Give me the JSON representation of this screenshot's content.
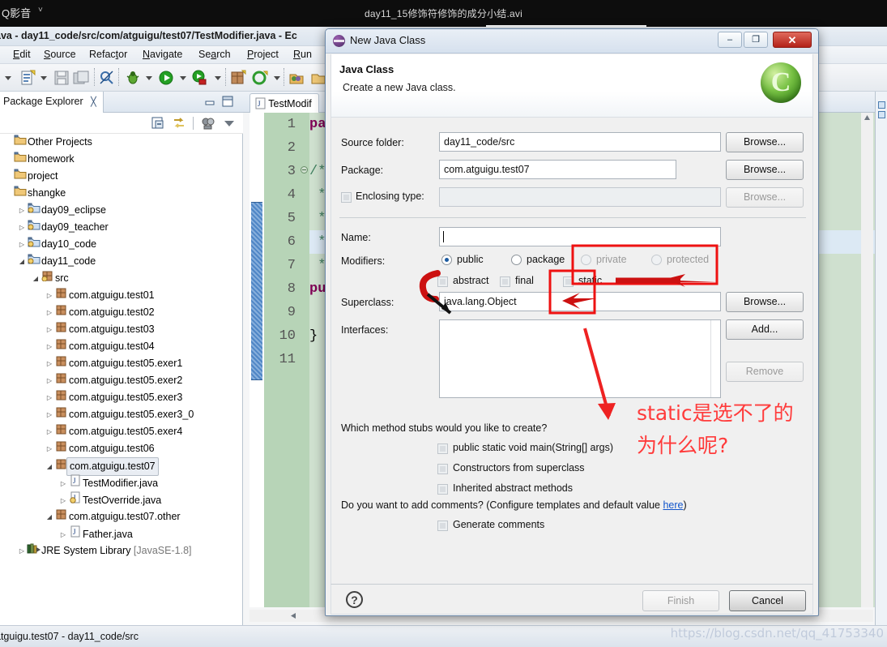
{
  "player": {
    "app_name": "Q影音",
    "caret": "˅",
    "video_title": "day11_15修饰符修饰的成分小结.avi"
  },
  "eclipse": {
    "window_title": "ava - day11_code/src/com/atguigu/test07/TestModifier.java - Ec",
    "menus": [
      "Edit",
      "Source",
      "Refactor",
      "Navigate",
      "Search",
      "Project",
      "Run"
    ],
    "status_text": "atguigu.test07 - day11_code/src"
  },
  "package_explorer": {
    "tab_label": "Package Explorer",
    "tab_close": "╳",
    "toolbar_icons": [
      "collapse-all-icon",
      "link-with-editor-icon",
      "view-menu-icon",
      "view-dropdown-icon"
    ],
    "minimize_label": "–",
    "maximize_label": "❐",
    "tree": [
      {
        "label": "Other Projects",
        "indent": 0,
        "twisty": "none",
        "icon": "project-folder-icon",
        "selected": false
      },
      {
        "label": "homework",
        "indent": 0,
        "twisty": "none",
        "icon": "project-folder-icon",
        "selected": false
      },
      {
        "label": "project",
        "indent": 0,
        "twisty": "none",
        "icon": "project-folder-icon",
        "selected": false
      },
      {
        "label": "shangke",
        "indent": 0,
        "twisty": "none",
        "icon": "project-folder-icon",
        "selected": false
      },
      {
        "label": "day09_eclipse",
        "indent": 1,
        "twisty": "collapsed",
        "icon": "java-project-icon",
        "selected": false
      },
      {
        "label": "day09_teacher",
        "indent": 1,
        "twisty": "collapsed",
        "icon": "java-project-icon",
        "selected": false
      },
      {
        "label": "day10_code",
        "indent": 1,
        "twisty": "collapsed",
        "icon": "java-project-icon",
        "selected": false
      },
      {
        "label": "day11_code",
        "indent": 1,
        "twisty": "expanded",
        "icon": "java-project-icon",
        "selected": false
      },
      {
        "label": "src",
        "indent": 2,
        "twisty": "expanded",
        "icon": "source-folder-icon",
        "selected": false
      },
      {
        "label": "com.atguigu.test01",
        "indent": 3,
        "twisty": "collapsed",
        "icon": "package-icon",
        "selected": false
      },
      {
        "label": "com.atguigu.test02",
        "indent": 3,
        "twisty": "collapsed",
        "icon": "package-icon",
        "selected": false
      },
      {
        "label": "com.atguigu.test03",
        "indent": 3,
        "twisty": "collapsed",
        "icon": "package-icon",
        "selected": false
      },
      {
        "label": "com.atguigu.test04",
        "indent": 3,
        "twisty": "collapsed",
        "icon": "package-icon",
        "selected": false
      },
      {
        "label": "com.atguigu.test05.exer1",
        "indent": 3,
        "twisty": "collapsed",
        "icon": "package-icon",
        "selected": false
      },
      {
        "label": "com.atguigu.test05.exer2",
        "indent": 3,
        "twisty": "collapsed",
        "icon": "package-icon",
        "selected": false
      },
      {
        "label": "com.atguigu.test05.exer3",
        "indent": 3,
        "twisty": "collapsed",
        "icon": "package-icon",
        "selected": false
      },
      {
        "label": "com.atguigu.test05.exer3_0",
        "indent": 3,
        "twisty": "collapsed",
        "icon": "package-icon",
        "selected": false
      },
      {
        "label": "com.atguigu.test05.exer4",
        "indent": 3,
        "twisty": "collapsed",
        "icon": "package-icon",
        "selected": false
      },
      {
        "label": "com.atguigu.test06",
        "indent": 3,
        "twisty": "collapsed",
        "icon": "package-icon",
        "selected": false
      },
      {
        "label": "com.atguigu.test07",
        "indent": 3,
        "twisty": "expanded",
        "icon": "package-icon",
        "selected": true
      },
      {
        "label": "TestModifier.java",
        "indent": 4,
        "twisty": "collapsed",
        "icon": "java-file-icon",
        "selected": false
      },
      {
        "label": "TestOverride.java",
        "indent": 4,
        "twisty": "collapsed",
        "icon": "java-file-warning-icon",
        "selected": false
      },
      {
        "label": "com.atguigu.test07.other",
        "indent": 3,
        "twisty": "expanded",
        "icon": "package-icon",
        "selected": false
      },
      {
        "label": "Father.java",
        "indent": 4,
        "twisty": "collapsed",
        "icon": "java-file-icon",
        "selected": false
      },
      {
        "label": "JRE System Library [JavaSE-1.8]",
        "indent": 1,
        "twisty": "collapsed",
        "icon": "library-icon",
        "selected": false
      }
    ]
  },
  "editor": {
    "tab_label": "TestModif",
    "line_numbers": [
      "1",
      "2",
      "3",
      "4",
      "5",
      "6",
      "7",
      "8",
      "9",
      "10",
      "11"
    ],
    "code_lines": [
      {
        "text": "pac",
        "kind": "keyword"
      },
      {
        "text": "",
        "kind": "plain"
      },
      {
        "text": "/*",
        "kind": "comment"
      },
      {
        "text": " *",
        "kind": "comment"
      },
      {
        "text": " *",
        "kind": "comment"
      },
      {
        "text": " *",
        "kind": "comment",
        "highlight": true
      },
      {
        "text": " */",
        "kind": "comment"
      },
      {
        "text": "pub",
        "kind": "keyword"
      },
      {
        "text": "",
        "kind": "plain"
      },
      {
        "text": "}",
        "kind": "plain"
      },
      {
        "text": "",
        "kind": "plain"
      }
    ]
  },
  "dialog": {
    "title": "New Java Class",
    "window_buttons": {
      "minimize": "–",
      "maximize": "❐",
      "close": "✕"
    },
    "header_title": "Java Class",
    "header_subtitle": "Create a new Java class.",
    "fields": {
      "source_folder_label": "Source folder:",
      "source_folder_value": "day11_code/src",
      "source_folder_browse": "Browse...",
      "package_label": "Package:",
      "package_value": "com.atguigu.test07",
      "package_browse": "Browse...",
      "enclosing_type_label": "Enclosing type:",
      "enclosing_type_value": "",
      "enclosing_type_browse": "Browse...",
      "name_label": "Name:",
      "name_value": "",
      "modifiers_label": "Modifiers:",
      "superclass_label": "Superclass:",
      "superclass_value": "java.lang.Object",
      "superclass_browse": "Browse...",
      "interfaces_label": "Interfaces:",
      "interfaces_add": "Add...",
      "interfaces_remove": "Remove"
    },
    "modifiers": {
      "radios": [
        {
          "label": "public",
          "selected": true,
          "enabled": true
        },
        {
          "label": "package",
          "selected": false,
          "enabled": true
        },
        {
          "label": "private",
          "selected": false,
          "enabled": false
        },
        {
          "label": "protected",
          "selected": false,
          "enabled": false
        }
      ],
      "checks": [
        {
          "label": "abstract",
          "checked": false,
          "enabled": false
        },
        {
          "label": "final",
          "checked": false,
          "enabled": false
        },
        {
          "label": "static",
          "checked": false,
          "enabled": false
        }
      ]
    },
    "stubs": {
      "question": "Which method stubs would you like to create?",
      "items": [
        {
          "label": "public static void main(String[] args)",
          "checked": false
        },
        {
          "label": "Constructors from superclass",
          "checked": false
        },
        {
          "label": "Inherited abstract methods",
          "checked": false
        }
      ]
    },
    "comments": {
      "question_prefix": "Do you want to add comments? (Configure templates and default value ",
      "link": "here",
      "question_suffix": ")",
      "checkbox_label": "Generate comments",
      "checked": false
    },
    "footer": {
      "help_icon": "?",
      "finish_label": "Finish",
      "finish_enabled": false,
      "cancel_label": "Cancel",
      "cancel_enabled": true
    }
  },
  "annotations": {
    "color": "#ee1111",
    "text_color": "#ff3b3b",
    "line1": "static是选不了的",
    "line2": "为什么呢?"
  },
  "watermark": "https://blog.csdn.net/qq_41753340"
}
